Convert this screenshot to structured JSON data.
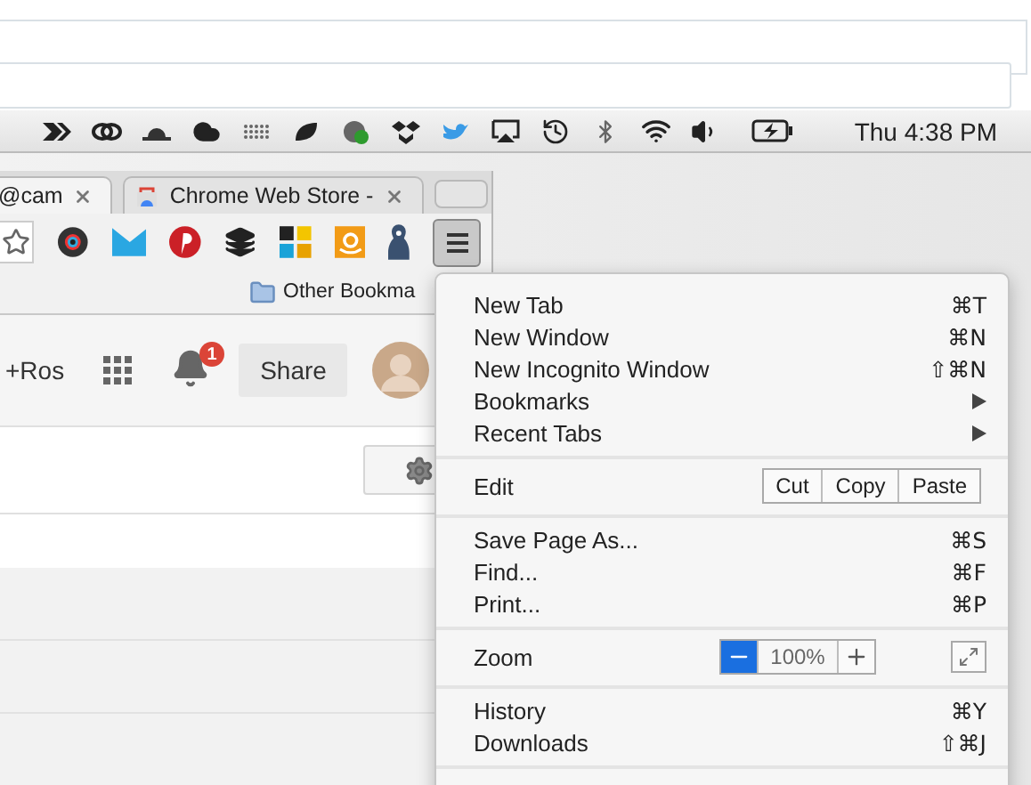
{
  "menubar": {
    "clock": "Thu 4:38 PM"
  },
  "tabs": [
    {
      "title": "@cam",
      "selected": true
    },
    {
      "title": "Chrome Web Store -",
      "selected": false
    }
  ],
  "bookmarks": [
    {
      "label": "Other Bookma"
    }
  ],
  "page": {
    "user": "+Ros",
    "notifications": "1",
    "share": "Share"
  },
  "menu": {
    "sections": [
      [
        {
          "kind": "item",
          "label": "New Tab",
          "shortcut": "⌘T"
        },
        {
          "kind": "item",
          "label": "New Window",
          "shortcut": "⌘N"
        },
        {
          "kind": "item",
          "label": "New Incognito Window",
          "shortcut": "⇧⌘N"
        },
        {
          "kind": "item",
          "label": "Bookmarks",
          "submenu": true
        },
        {
          "kind": "item",
          "label": "Recent Tabs",
          "submenu": true
        }
      ],
      [
        {
          "kind": "edit",
          "label": "Edit",
          "buttons": [
            "Cut",
            "Copy",
            "Paste"
          ]
        }
      ],
      [
        {
          "kind": "item",
          "label": "Save Page As...",
          "shortcut": "⌘S"
        },
        {
          "kind": "item",
          "label": "Find...",
          "shortcut": "⌘F"
        },
        {
          "kind": "item",
          "label": "Print...",
          "shortcut": "⌘P"
        }
      ],
      [
        {
          "kind": "zoom",
          "label": "Zoom",
          "value": "100%",
          "minus_pressed": true
        }
      ],
      [
        {
          "kind": "item",
          "label": "History",
          "shortcut": "⌘Y"
        },
        {
          "kind": "item",
          "label": "Downloads",
          "shortcut": "⇧⌘J"
        }
      ]
    ]
  }
}
